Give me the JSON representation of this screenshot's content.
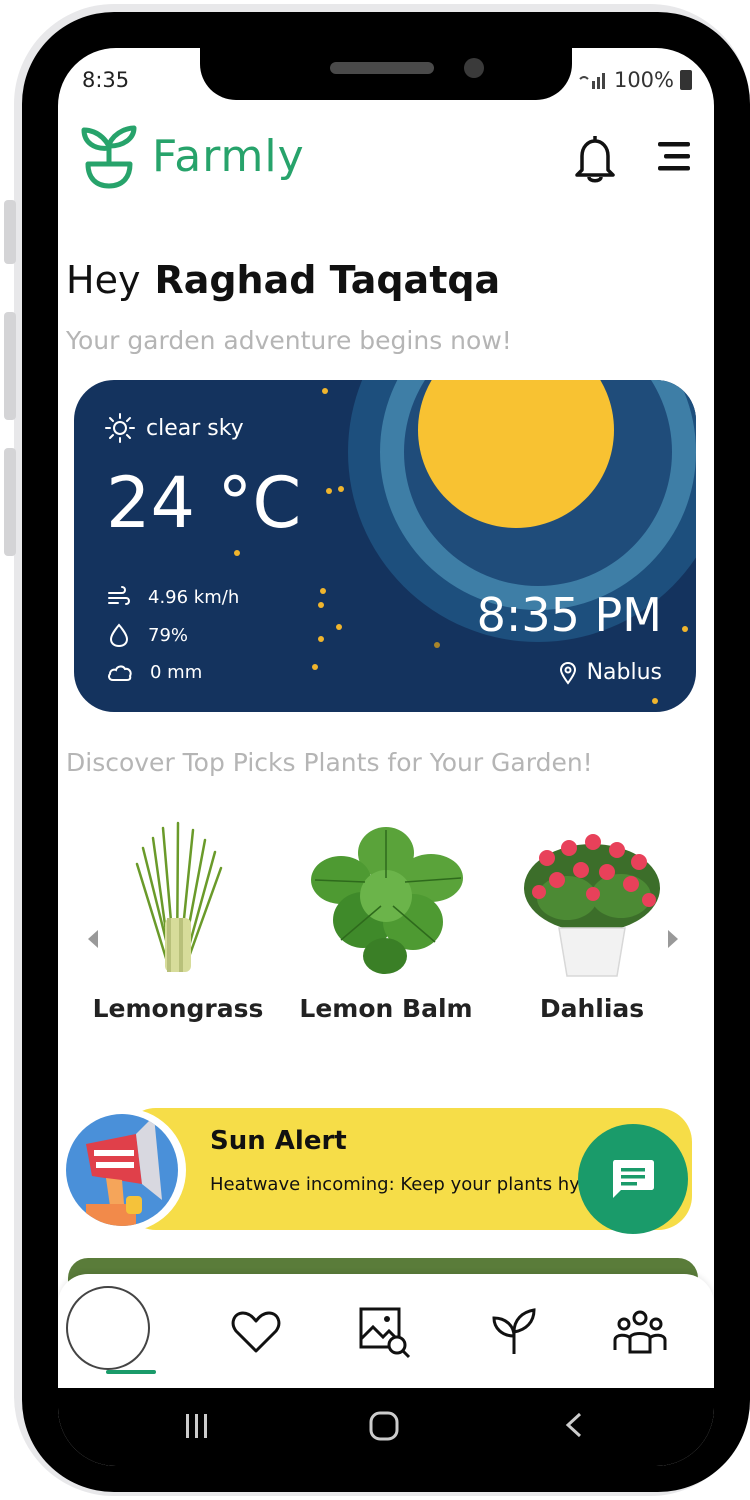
{
  "status_bar": {
    "time": "8:35",
    "battery": "100%"
  },
  "header": {
    "app_name": "Farmly"
  },
  "greeting": {
    "hey": "Hey",
    "name": "Raghad Taqatqa",
    "subtitle": "Your garden adventure begins now!"
  },
  "weather": {
    "condition": "clear sky",
    "temperature": "24 °C",
    "wind": "4.96 km/h",
    "humidity": "79%",
    "precipitation": "0 mm",
    "time": "8:35 PM",
    "location": "Nablus"
  },
  "discover": {
    "title": "Discover Top Picks Plants for Your Garden!",
    "plants": [
      {
        "name": "Lemongrass"
      },
      {
        "name": "Lemon Balm"
      },
      {
        "name": "Dahlias"
      }
    ]
  },
  "alert": {
    "title": "Sun Alert",
    "message": "Heatwave incoming: Keep your plants hydrated!"
  },
  "nav": {
    "items": [
      "home-icon",
      "heart-icon",
      "image-search-icon",
      "plant-icon",
      "community-icon"
    ]
  },
  "colors": {
    "brand_green": "#27a36b",
    "weather_bg": "#14335e",
    "sun": "#f8c232",
    "alert_bg": "#f6dd48",
    "fab": "#1a9b6a"
  }
}
